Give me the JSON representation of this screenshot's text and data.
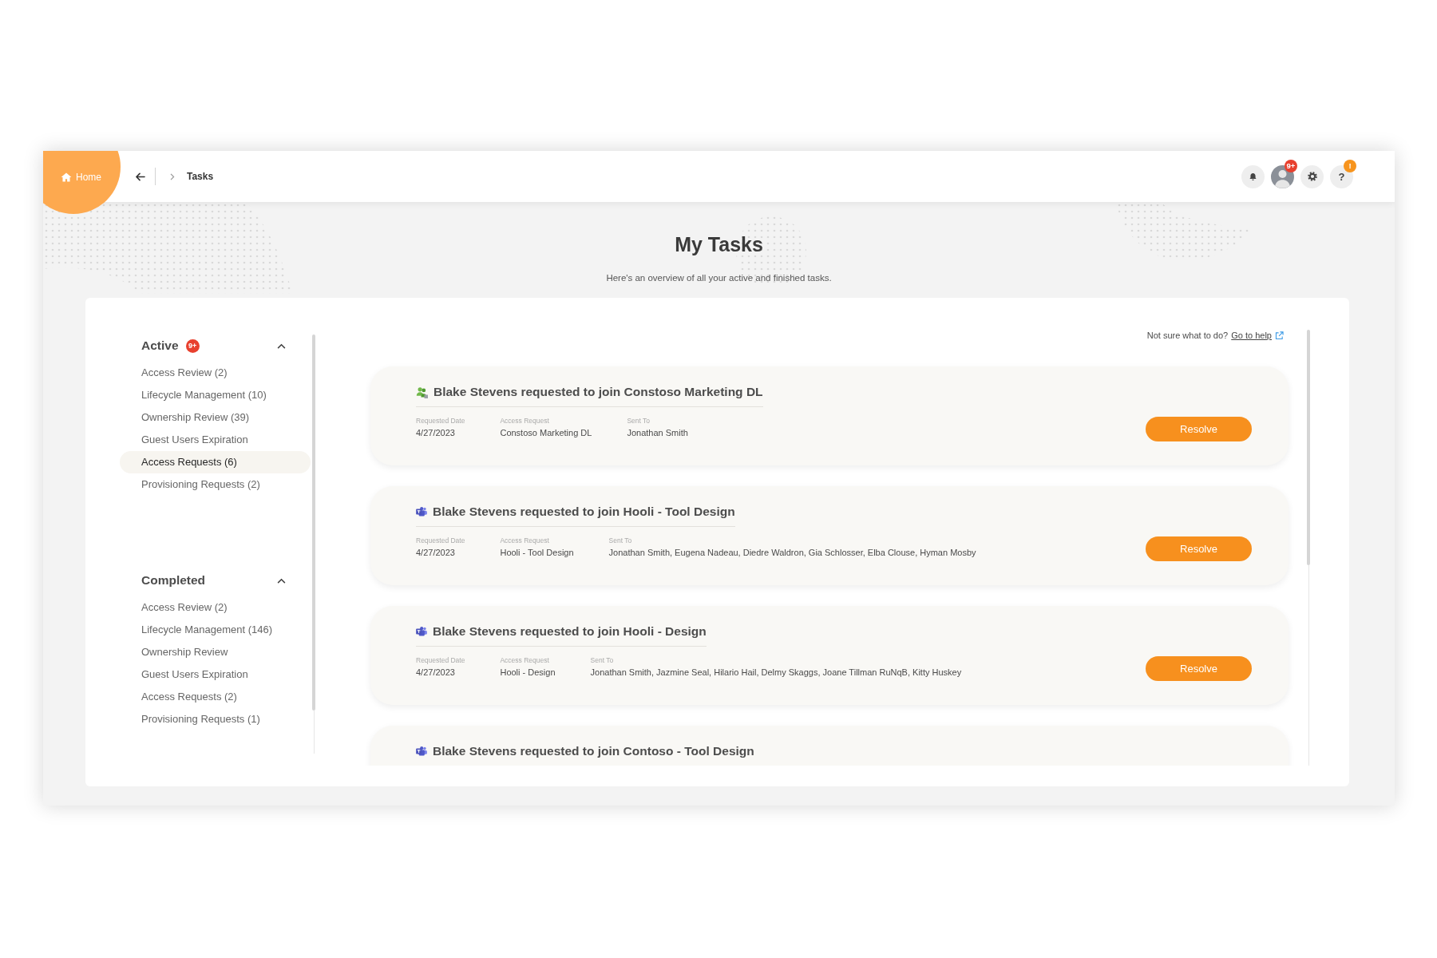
{
  "header": {
    "home": "Home",
    "breadcrumb": [
      {
        "label": "Tasks"
      }
    ],
    "toolbar": [
      {
        "kind": "bell"
      },
      {
        "kind": "avatar",
        "badge": "9+"
      },
      {
        "kind": "settings"
      },
      {
        "kind": "help",
        "label": "?",
        "badge": "!"
      }
    ]
  },
  "page": {
    "title": "My Tasks",
    "subtitle": "Here's an overview of all your active and finished tasks."
  },
  "sidebar": {
    "sections": [
      {
        "title": "Active",
        "badge": "9+",
        "expanded": true,
        "items": [
          {
            "label": "Access Review (2)",
            "selected": false
          },
          {
            "label": "Lifecycle Management (10)",
            "selected": false
          },
          {
            "label": "Ownership Review (39)",
            "selected": false
          },
          {
            "label": "Guest Users Expiration",
            "selected": false
          },
          {
            "label": "Access Requests (6)",
            "selected": true
          },
          {
            "label": "Provisioning Requests (2)",
            "selected": false
          }
        ]
      },
      {
        "title": "Completed",
        "expanded": true,
        "items": [
          {
            "label": "Access Review (2)",
            "selected": false
          },
          {
            "label": "Lifecycle Management (146)",
            "selected": false
          },
          {
            "label": "Ownership Review",
            "selected": false
          },
          {
            "label": "Guest Users Expiration",
            "selected": false
          },
          {
            "label": "Access Requests (2)",
            "selected": false
          },
          {
            "label": "Provisioning Requests (1)",
            "selected": false
          }
        ]
      }
    ]
  },
  "help": {
    "prompt": "Not sure what to do?",
    "link": "Go to help"
  },
  "tasks": [
    {
      "kind": "group",
      "title": "Blake Stevens requested to join Constoso Marketing DL",
      "fields": [
        {
          "label": "Requested Date",
          "value": "4/27/2023"
        },
        {
          "label": "Access Request",
          "value": "Constoso Marketing DL"
        },
        {
          "label": "Sent To",
          "value": "Jonathan Smith"
        }
      ],
      "button": "Resolve"
    },
    {
      "kind": "team",
      "title": "Blake Stevens requested to join Hooli - Tool Design",
      "fields": [
        {
          "label": "Requested Date",
          "value": "4/27/2023"
        },
        {
          "label": "Access Request",
          "value": "Hooli - Tool Design"
        },
        {
          "label": "Sent To",
          "value": "Jonathan Smith, Eugena Nadeau, Diedre Waldron, Gia Schlosser, Elba Clouse, Hyman Mosby"
        }
      ],
      "button": "Resolve"
    },
    {
      "kind": "team",
      "title": "Blake Stevens requested to join Hooli - Design",
      "fields": [
        {
          "label": "Requested Date",
          "value": "4/27/2023"
        },
        {
          "label": "Access Request",
          "value": "Hooli - Design"
        },
        {
          "label": "Sent To",
          "value": "Jonathan Smith, Jazmine Seal, Hilario Hail, Delmy Skaggs, Joane Tillman RuNqB, Kitty Huskey"
        }
      ],
      "button": "Resolve"
    },
    {
      "kind": "team",
      "title": "Blake Stevens requested to join Contoso - Tool Design"
    }
  ]
}
